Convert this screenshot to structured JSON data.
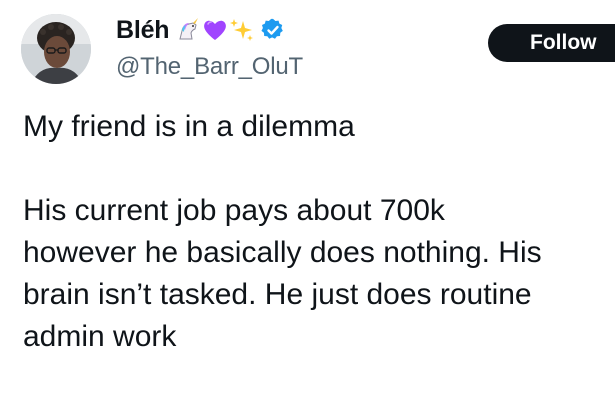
{
  "author": {
    "display_name": "Bléh",
    "name_emojis": [
      "unicorn-emoji",
      "purple-heart-emoji",
      "sparkles-emoji"
    ],
    "verified": true,
    "handle": "@The_Barr_OluT",
    "avatar_icon": "profile-photo"
  },
  "actions": {
    "follow_label": "Follow"
  },
  "tweet": {
    "paragraphs": [
      [
        "My friend is in a dilemma"
      ],
      [
        "His current job pays about 700k",
        "however he basically does nothing. His",
        "brain isn’t tasked. He just does routine",
        "admin work"
      ]
    ]
  },
  "colors": {
    "text_primary": "#0f1419",
    "text_secondary": "#536471",
    "verified_blue": "#1d9bf0",
    "follow_bg": "#0f1419",
    "follow_text": "#ffffff"
  }
}
